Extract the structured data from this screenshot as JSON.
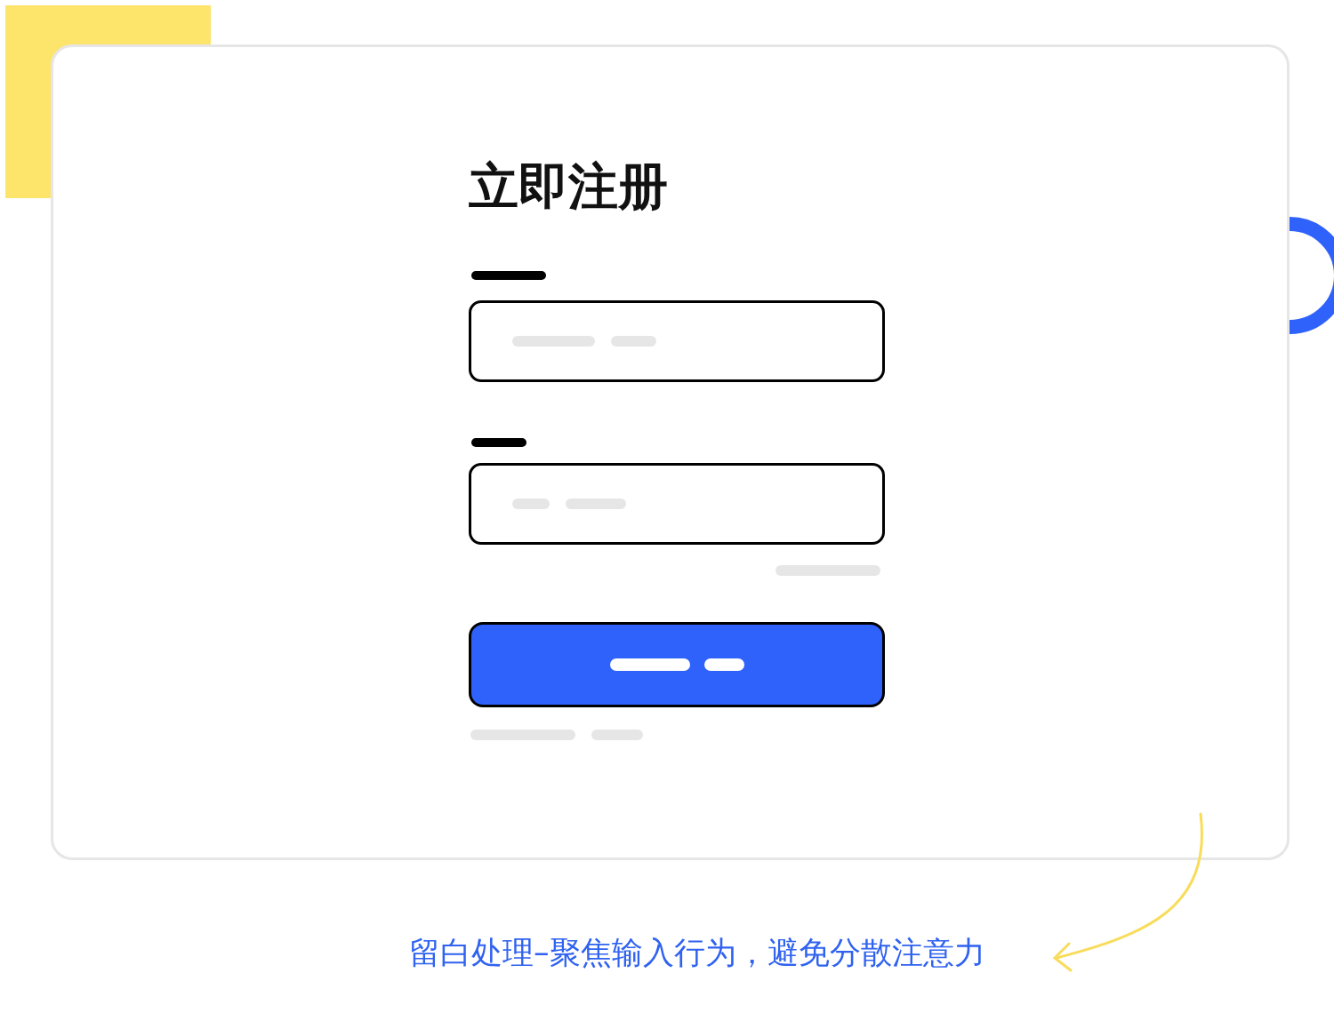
{
  "title": "立即注册",
  "caption": "留白处理–聚焦输入行为，避免分散注意力"
}
